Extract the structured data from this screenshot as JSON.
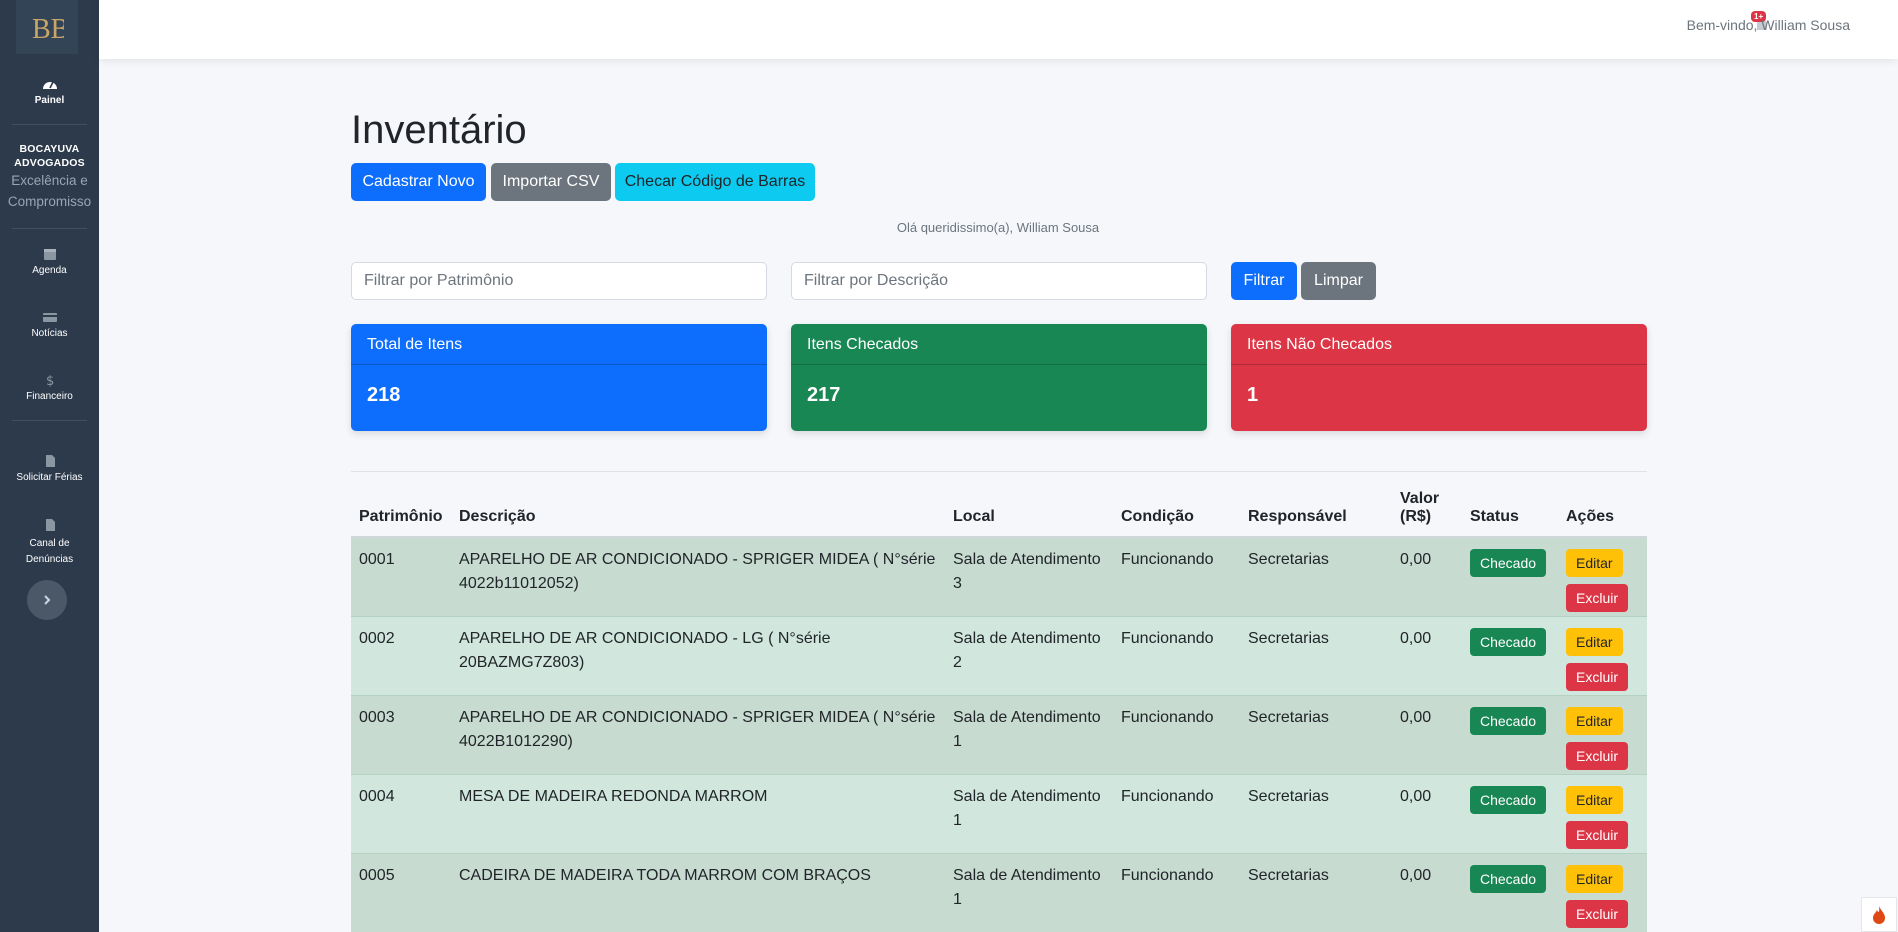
{
  "sidebar": {
    "logo": "BB",
    "items": [
      {
        "label": "Painel",
        "icon": "gauge-icon"
      },
      {
        "label": "Agenda",
        "icon": "calendar-icon"
      },
      {
        "label": "Notícias",
        "icon": "card-icon"
      },
      {
        "label": "Financeiro",
        "icon": "dollar-icon"
      },
      {
        "label": "Solicitar Férias",
        "icon": "file-icon"
      },
      {
        "label": "Canal de",
        "label2": "Denúncias",
        "icon": "file-icon"
      }
    ],
    "brand_line1": "BOCAYUVA",
    "brand_line2": "ADVOGADOS",
    "brand_line3": "Excelência e",
    "brand_line4": "Compromisso"
  },
  "topbar": {
    "notif_badge": "1+",
    "welcome": "Bem-vindo, William Sousa"
  },
  "main": {
    "title": "Inventário",
    "buttons": {
      "new": "Cadastrar Novo",
      "import": "Importar CSV",
      "barcode": "Checar Código de Barras",
      "filter": "Filtrar",
      "clear": "Limpar"
    },
    "greeting": "Olá queridissimo(a), William Sousa",
    "filters": {
      "patrimonio_placeholder": "Filtrar por Patrimônio",
      "descricao_placeholder": "Filtrar por Descrição"
    },
    "cards": {
      "total_label": "Total de Itens",
      "total_value": "218",
      "checked_label": "Itens Checados",
      "checked_value": "217",
      "unchecked_label": "Itens Não Checados",
      "unchecked_value": "1"
    },
    "table": {
      "headers": {
        "patrimonio": "Patrimônio",
        "descricao": "Descrição",
        "local": "Local",
        "condicao": "Condição",
        "responsavel": "Responsável",
        "valor1": "Valor",
        "valor2": "(R$)",
        "status": "Status",
        "acoes": "Ações"
      },
      "rows": [
        {
          "patrimonio": "0001",
          "descricao": "APARELHO DE AR CONDICIONADO - SPRIGER MIDEA ( N°série 4022b11012052)",
          "local": "Sala de Atendimento 3",
          "condicao": "Funcionando",
          "responsavel": "Secretarias",
          "valor": "0,00",
          "status": "Checado",
          "edit": "Editar",
          "delete": "Excluir"
        },
        {
          "patrimonio": "0002",
          "descricao": "APARELHO DE AR CONDICIONADO - LG ( N°série 20BAZMG7Z803)",
          "local": "Sala de Atendimento 2",
          "condicao": "Funcionando",
          "responsavel": "Secretarias",
          "valor": "0,00",
          "status": "Checado",
          "edit": "Editar",
          "delete": "Excluir"
        },
        {
          "patrimonio": "0003",
          "descricao": "APARELHO DE AR CONDICIONADO - SPRIGER MIDEA ( N°série 4022B1012290)",
          "local": "Sala de Atendimento 1",
          "condicao": "Funcionando",
          "responsavel": "Secretarias",
          "valor": "0,00",
          "status": "Checado",
          "edit": "Editar",
          "delete": "Excluir"
        },
        {
          "patrimonio": "0004",
          "descricao": "MESA DE MADEIRA REDONDA MARROM",
          "local": "Sala de Atendimento 1",
          "condicao": "Funcionando",
          "responsavel": "Secretarias",
          "valor": "0,00",
          "status": "Checado",
          "edit": "Editar",
          "delete": "Excluir"
        },
        {
          "patrimonio": "0005",
          "descricao": "CADEIRA DE MADEIRA TODA MARROM COM BRAÇOS",
          "local": "Sala de Atendimento 1",
          "condicao": "Funcionando",
          "responsavel": "Secretarias",
          "valor": "0,00",
          "status": "Checado",
          "edit": "Editar",
          "delete": "Excluir"
        }
      ]
    }
  },
  "colors": {
    "primary": "#0d6efd",
    "secondary": "#6c757d",
    "info": "#0dcaf0",
    "success": "#198754",
    "danger": "#dc3545",
    "warning": "#ffc107",
    "sidebar": "#2c3a4b"
  }
}
